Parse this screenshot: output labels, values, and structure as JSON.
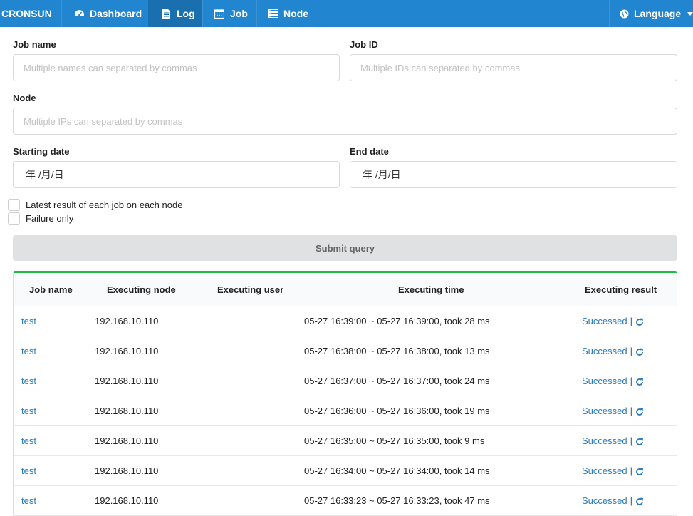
{
  "nav": {
    "brand": "CRONSUN",
    "items": [
      {
        "label": "Dashboard",
        "icon": "dashboard-icon"
      },
      {
        "label": "Log",
        "icon": "file-icon"
      },
      {
        "label": "Job",
        "icon": "calendar-icon"
      },
      {
        "label": "Node",
        "icon": "server-icon"
      }
    ],
    "active": "Log",
    "language": {
      "label": "Language",
      "icon": "globe-icon"
    }
  },
  "form": {
    "job_name": {
      "label": "Job name",
      "placeholder": "Multiple names can separated by commas",
      "value": ""
    },
    "job_id": {
      "label": "Job ID",
      "placeholder": "Multiple IDs can separated by commas",
      "value": ""
    },
    "node": {
      "label": "Node",
      "placeholder": "Multiple IPs can separated by commas",
      "value": ""
    },
    "start_date": {
      "label": "Starting date",
      "value": "年 /月/日"
    },
    "end_date": {
      "label": "End date",
      "value": "年 /月/日"
    },
    "latest_only": {
      "label": "Latest result of each job on each node",
      "checked": false
    },
    "failure_only": {
      "label": "Failure only",
      "checked": false
    },
    "submit_label": "Submit query"
  },
  "table": {
    "accent_color": "#21ba45",
    "headers": [
      "Job name",
      "Executing node",
      "Executing user",
      "Executing time",
      "Executing result"
    ],
    "rows": [
      {
        "job": "test",
        "node": "192.168.10.110",
        "user": "",
        "time": "05-27 16:39:00 ~ 05-27 16:39:00, took 28 ms",
        "result": "Successed"
      },
      {
        "job": "test",
        "node": "192.168.10.110",
        "user": "",
        "time": "05-27 16:38:00 ~ 05-27 16:38:00, took 13 ms",
        "result": "Successed"
      },
      {
        "job": "test",
        "node": "192.168.10.110",
        "user": "",
        "time": "05-27 16:37:00 ~ 05-27 16:37:00, took 24 ms",
        "result": "Successed"
      },
      {
        "job": "test",
        "node": "192.168.10.110",
        "user": "",
        "time": "05-27 16:36:00 ~ 05-27 16:36:00, took 19 ms",
        "result": "Successed"
      },
      {
        "job": "test",
        "node": "192.168.10.110",
        "user": "",
        "time": "05-27 16:35:00 ~ 05-27 16:35:00, took 9 ms",
        "result": "Successed"
      },
      {
        "job": "test",
        "node": "192.168.10.110",
        "user": "",
        "time": "05-27 16:34:00 ~ 05-27 16:34:00, took 14 ms",
        "result": "Successed"
      },
      {
        "job": "test",
        "node": "192.168.10.110",
        "user": "",
        "time": "05-27 16:33:23 ~ 05-27 16:33:23, took 47 ms",
        "result": "Successed"
      }
    ]
  }
}
